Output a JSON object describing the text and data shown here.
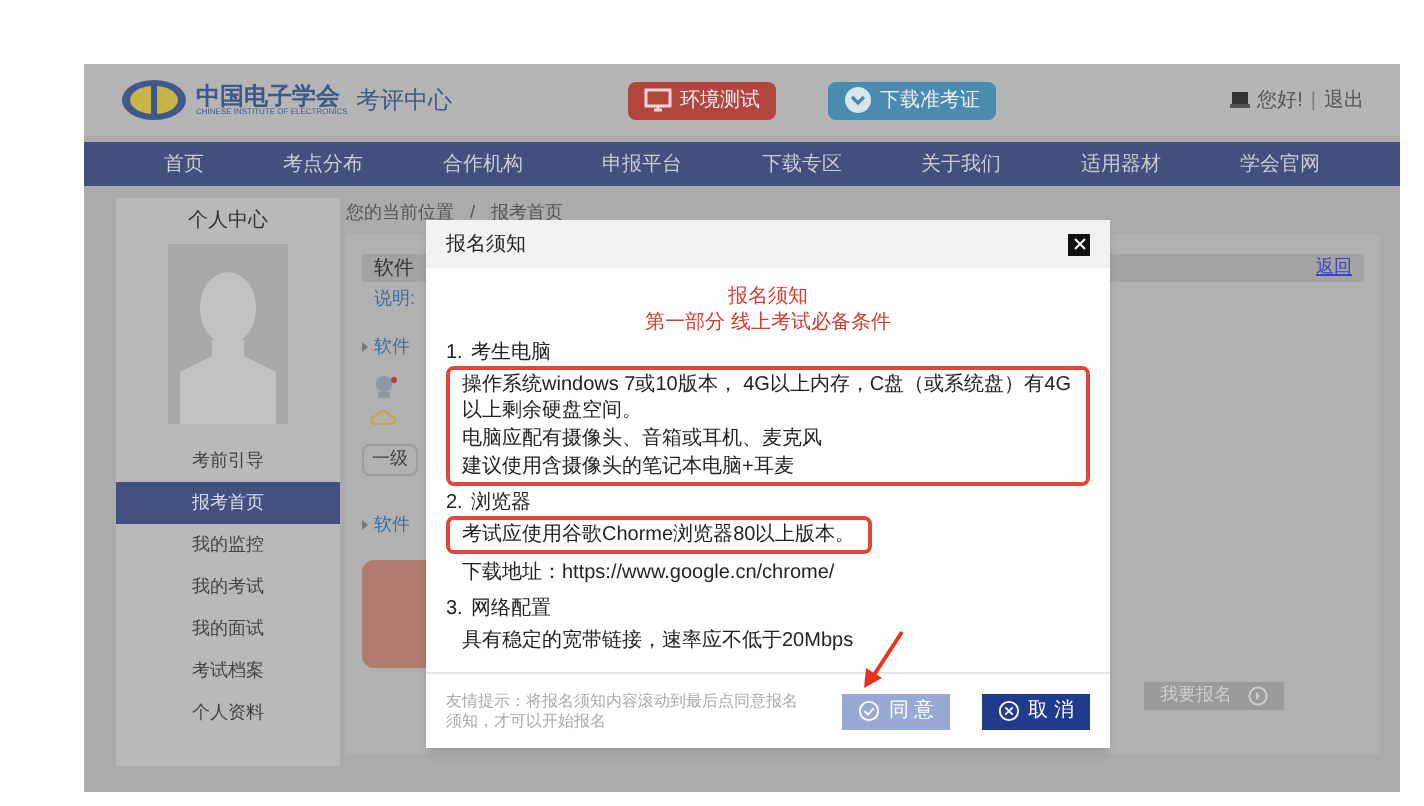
{
  "header": {
    "logo_title": "中国电子学会",
    "logo_subtitle": "CHINESE INSTITUTE OF ELECTRONICS",
    "site_name": "考评中心",
    "buttons": [
      {
        "label": "环境测试",
        "kind": "test"
      },
      {
        "label": "下载准考证",
        "kind": "download"
      }
    ],
    "greeting": "您好!",
    "separator": "|",
    "logout": "退出"
  },
  "nav": [
    "首页",
    "考点分布",
    "合作机构",
    "申报平台",
    "下载专区",
    "关于我们",
    "适用器材",
    "学会官网"
  ],
  "sidebar": {
    "title": "个人中心",
    "items": [
      {
        "label": "考前引导",
        "selected": false
      },
      {
        "label": "报考首页",
        "selected": true
      },
      {
        "label": "我的监控",
        "selected": false
      },
      {
        "label": "我的考试",
        "selected": false
      },
      {
        "label": "我的面试",
        "selected": false
      },
      {
        "label": "考试档案",
        "selected": false
      },
      {
        "label": "个人资料",
        "selected": false
      }
    ]
  },
  "breadcrumb": {
    "items": [
      "您的当前位置",
      "报考首页"
    ],
    "separator": "/"
  },
  "content": {
    "card_title": "软件",
    "back_link": "返回",
    "note": "说明:",
    "section_links": [
      "软件",
      "软件"
    ],
    "level": "一级",
    "apply_button": "我要报名"
  },
  "dialog": {
    "title": "报名须知",
    "heading": "报名须知",
    "subheading": "第一部分 线上考试必备条件",
    "sections": [
      {
        "number": "1.",
        "title": "考生电脑",
        "blocks": [
          {
            "highlighted": true,
            "lines": [
              "操作系统windows 7或10版本， 4G以上内存，C盘（或系统盘）有4G以上剩余硬盘空间。",
              "电脑应配有摄像头、音箱或耳机、麦克风",
              "建议使用含摄像头的笔记本电脑+耳麦"
            ]
          }
        ]
      },
      {
        "number": "2.",
        "title": "浏览器",
        "blocks": [
          {
            "highlighted": true,
            "lines": [
              "考试应使用谷歌Chorme浏览器80以上版本。"
            ]
          },
          {
            "highlighted": false,
            "lines": [
              "下载地址：https://www.google.cn/chrome/"
            ]
          }
        ]
      },
      {
        "number": "3.",
        "title": "网络配置",
        "blocks": [
          {
            "highlighted": false,
            "lines": [
              "具有稳定的宽带链接，速率应不低于20Mbps"
            ]
          }
        ]
      }
    ],
    "hint": "友情提示：将报名须知内容滚动到最后点同意报名须知，才可以开始报名",
    "buttons": [
      {
        "label": "同 意",
        "kind": "agree",
        "disabled": true
      },
      {
        "label": "取 消",
        "kind": "cancel",
        "disabled": false
      }
    ]
  }
}
